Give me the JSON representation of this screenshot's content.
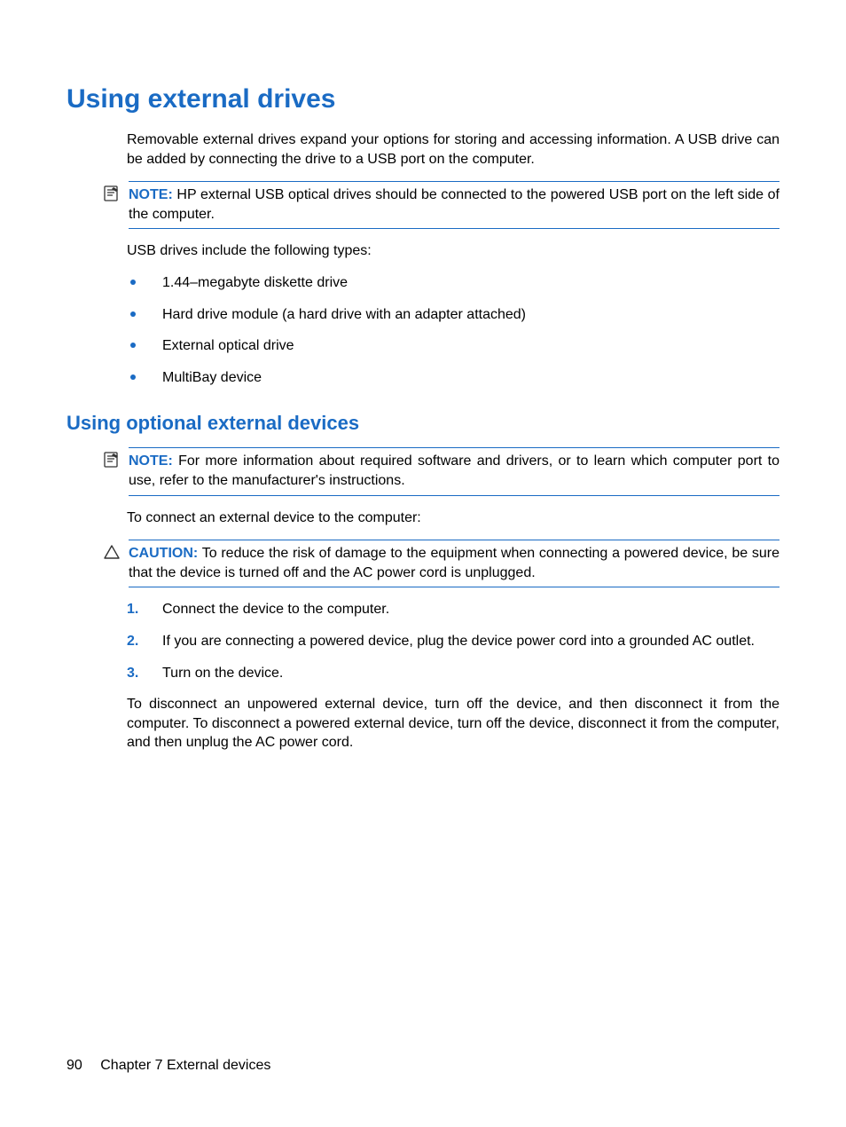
{
  "heading1": "Using external drives",
  "intro": "Removable external drives expand your options for storing and accessing information. A USB drive can be added by connecting the drive to a USB port on the computer.",
  "note1": {
    "label": "NOTE:",
    "text": "HP external USB optical drives should be connected to the powered USB port on the left side of the computer."
  },
  "usb_intro": "USB drives include the following types:",
  "usb_types": [
    "1.44–megabyte diskette drive",
    "Hard drive module (a hard drive with an adapter attached)",
    "External optical drive",
    "MultiBay device"
  ],
  "heading2": "Using optional external devices",
  "note2": {
    "label": "NOTE:",
    "text": "For more information about required software and drivers, or to learn which computer port to use, refer to the manufacturer's instructions."
  },
  "connect_intro": "To connect an external device to the computer:",
  "caution": {
    "label": "CAUTION:",
    "text": "To reduce the risk of damage to the equipment when connecting a powered device, be sure that the device is turned off and the AC power cord is unplugged."
  },
  "steps": [
    "Connect the device to the computer.",
    "If you are connecting a powered device, plug the device power cord into a grounded AC outlet.",
    "Turn on the device."
  ],
  "disconnect": "To disconnect an unpowered external device, turn off the device, and then disconnect it from the computer. To disconnect a powered external device, turn off the device, disconnect it from the computer, and then unplug the AC power cord.",
  "footer": {
    "page": "90",
    "chapter": "Chapter 7   External devices"
  }
}
